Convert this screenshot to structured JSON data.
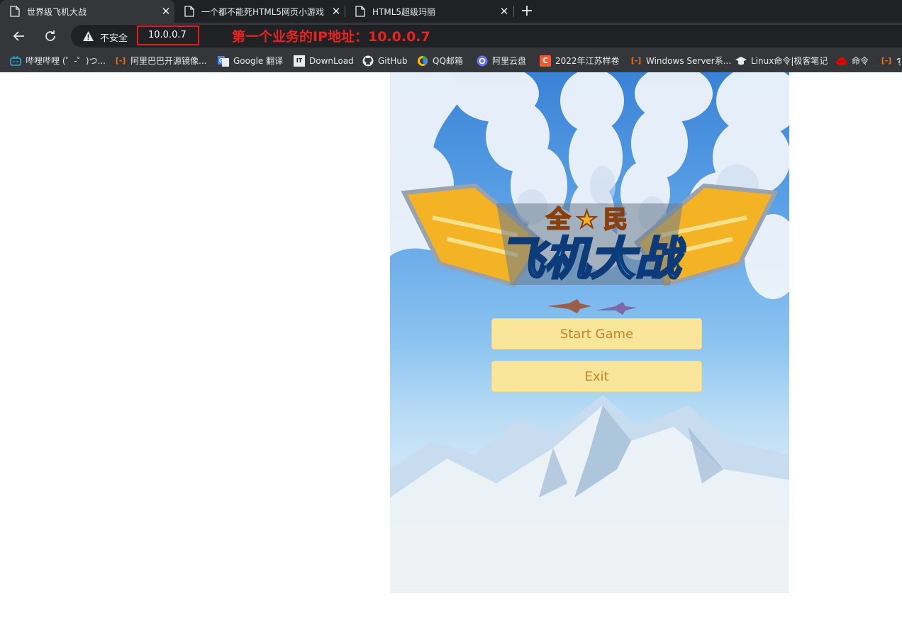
{
  "browser": {
    "tabs": [
      {
        "title": "世界级飞机大战",
        "active": true
      },
      {
        "title": "一个都不能死HTML5网页小游戏",
        "active": false
      },
      {
        "title": "HTML5超级玛丽",
        "active": false
      }
    ],
    "new_tab_symbol": "+",
    "close_symbol": "✕"
  },
  "toolbar": {
    "security_label": "不安全",
    "url": "10.0.0.7",
    "annotation": "第一个业务的IP地址：10.0.0.7",
    "annotation_color": "#e8221f"
  },
  "bookmarks": [
    {
      "label": "哔哩哔哩 (゜-゜)つ...",
      "icon": "bilibili-icon"
    },
    {
      "label": "阿里巴巴开源镜像...",
      "icon": "alibaba-icon"
    },
    {
      "label": "Google 翻译",
      "icon": "google-translate-icon"
    },
    {
      "label": "DownLoad",
      "icon": "download-icon"
    },
    {
      "label": "GitHub",
      "icon": "github-icon"
    },
    {
      "label": "QQ邮箱",
      "icon": "qqmail-icon"
    },
    {
      "label": "阿里云盘",
      "icon": "aliyun-drive-icon"
    },
    {
      "label": "2022年江苏样卷",
      "icon": "csdn-icon"
    },
    {
      "label": "Windows Server系...",
      "icon": "alibaba-icon"
    },
    {
      "label": "Linux命令|极客笔记",
      "icon": "graduation-cap-icon"
    },
    {
      "label": "命令",
      "icon": "redhat-icon"
    },
    {
      "label": "รุ",
      "icon": "alibaba-icon"
    }
  ],
  "game": {
    "logo_lettering": "全民飞机大战",
    "buttons": [
      {
        "label": "Start Game"
      },
      {
        "label": "Exit"
      }
    ],
    "button_bg": "#fae69a",
    "button_text_color": "#c8822a"
  }
}
